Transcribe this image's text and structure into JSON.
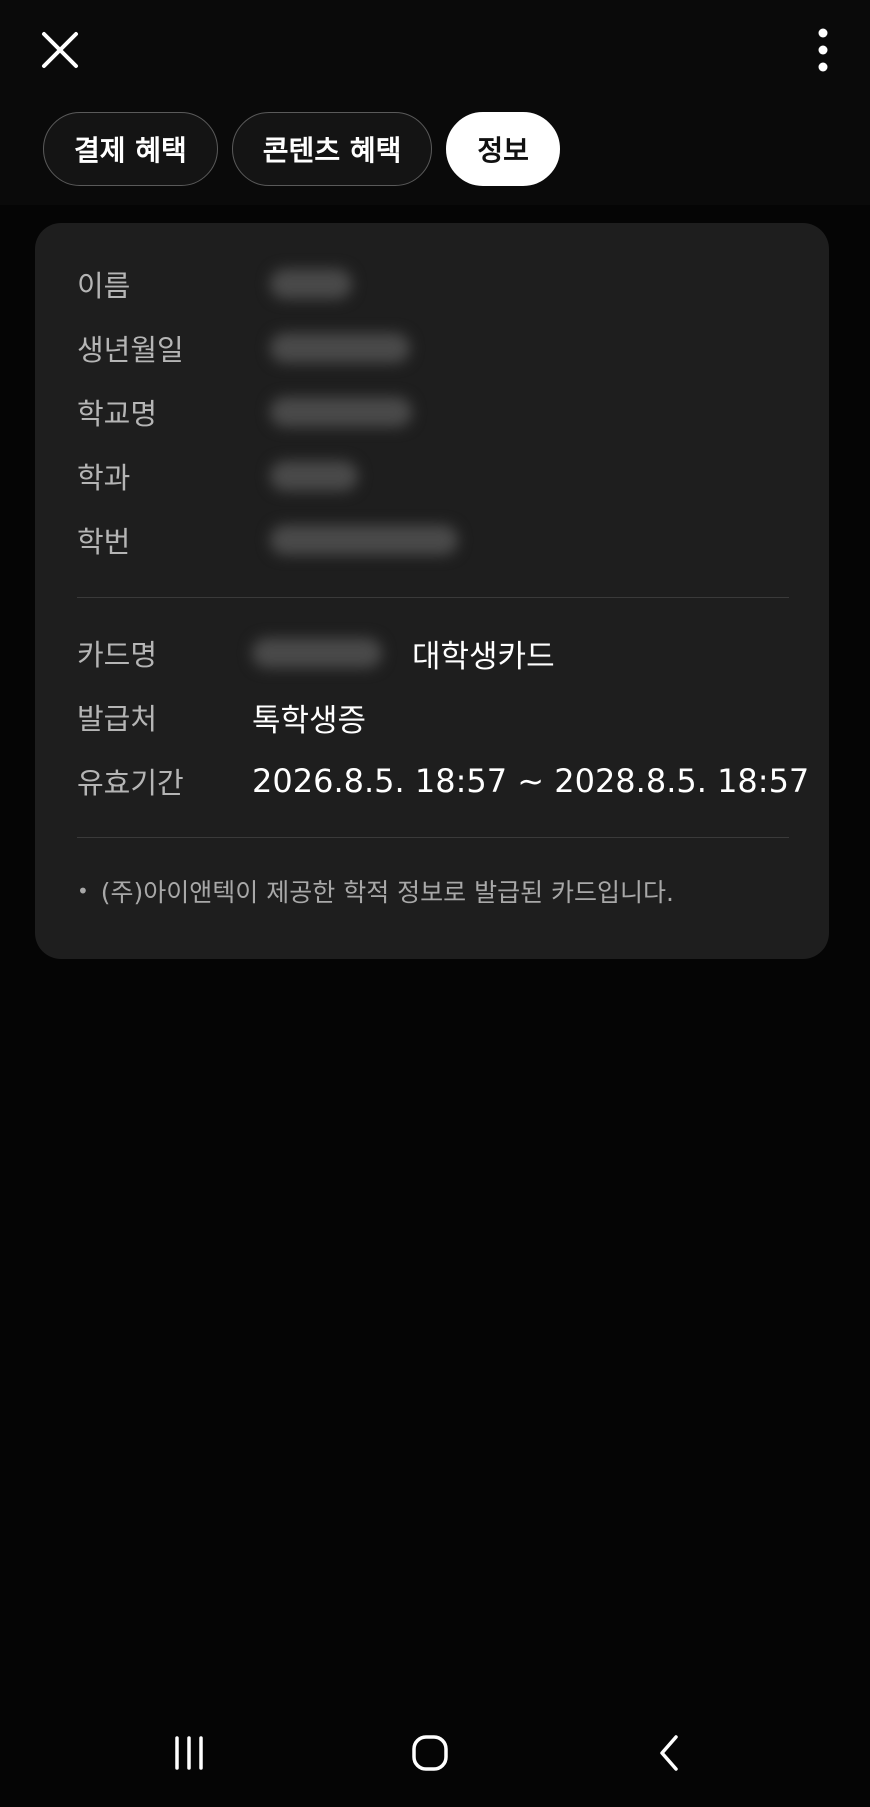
{
  "header": {
    "close_icon": "close-icon",
    "more_icon": "more-vertical-icon"
  },
  "tabs": [
    {
      "label": "결제 혜택",
      "active": false
    },
    {
      "label": "콘텐츠 혜택",
      "active": false
    },
    {
      "label": "정보",
      "active": true
    }
  ],
  "student_info": {
    "name_label": "이름",
    "birth_label": "생년월일",
    "school_label": "학교명",
    "major_label": "학과",
    "student_id_label": "학번"
  },
  "card_info": {
    "card_name_label": "카드명",
    "card_name_suffix": "대학생카드",
    "issuer_label": "발급처",
    "issuer_value": "톡학생증",
    "validity_label": "유효기간",
    "validity_value": "2026.8.5. 18:57 ~ 2028.8.5. 18:57"
  },
  "note": {
    "text": "(주)아이앤텍이 제공한 학적 정보로 발급된 카드입니다."
  },
  "navbar": {
    "recents_icon": "recent-apps-icon",
    "home_icon": "home-icon",
    "back_icon": "back-icon"
  },
  "colors": {
    "background": "#050505",
    "card": "#1e1e1e",
    "active_tab": "#ffffff"
  }
}
